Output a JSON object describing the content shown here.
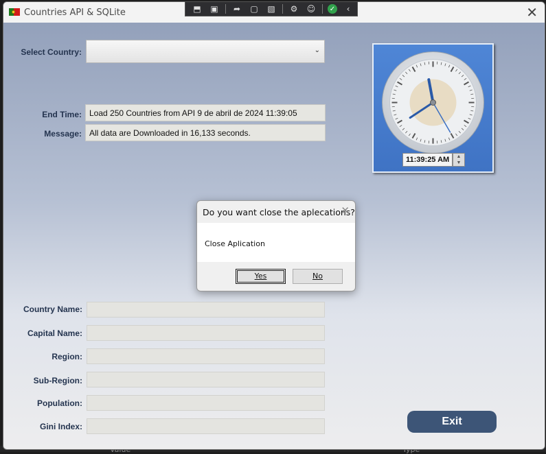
{
  "background": {
    "bottom_labels": [
      "Value",
      "Type"
    ]
  },
  "window": {
    "title": "Countries API & SQLite",
    "flag_icon": "portugal-flag-icon",
    "close_glyph": "✕"
  },
  "debug_toolbar": {
    "icons": [
      "select-element-icon",
      "live-preview-icon",
      "pointer-select-icon",
      "layout-adorners-icon",
      "track-focus-icon",
      "binding-failures-icon",
      "accessibility-icon",
      "hot-reload-ok-icon",
      "collapse-toolbar-icon"
    ]
  },
  "form": {
    "select_country_label": "Select Country:",
    "select_country_value": "",
    "end_time_label": "End Time:",
    "end_time_value": "Load 250 Countries from API 9 de abril de 2024 11:39:05",
    "message_label": "Message:",
    "message_value": "All data are Downloaded in 16,133 seconds.",
    "details": [
      {
        "label": "Country Name:",
        "value": ""
      },
      {
        "label": "Capital Name:",
        "value": ""
      },
      {
        "label": "Region:",
        "value": ""
      },
      {
        "label": "Sub-Region:",
        "value": ""
      },
      {
        "label": "Population:",
        "value": ""
      },
      {
        "label": "Gini Index:",
        "value": ""
      }
    ]
  },
  "clock": {
    "time_text": "11:39:25 AM",
    "hour": 11,
    "minute": 39,
    "second": 25
  },
  "dialog": {
    "title": "Do you want close the aplecations?",
    "message": "Close Aplication",
    "yes_label": "Yes",
    "no_label": "No"
  },
  "exit_label": "Exit",
  "colors": {
    "label": "#24344f",
    "exit_button": "#3d5577",
    "clock_panel": "#4a7fd0"
  }
}
